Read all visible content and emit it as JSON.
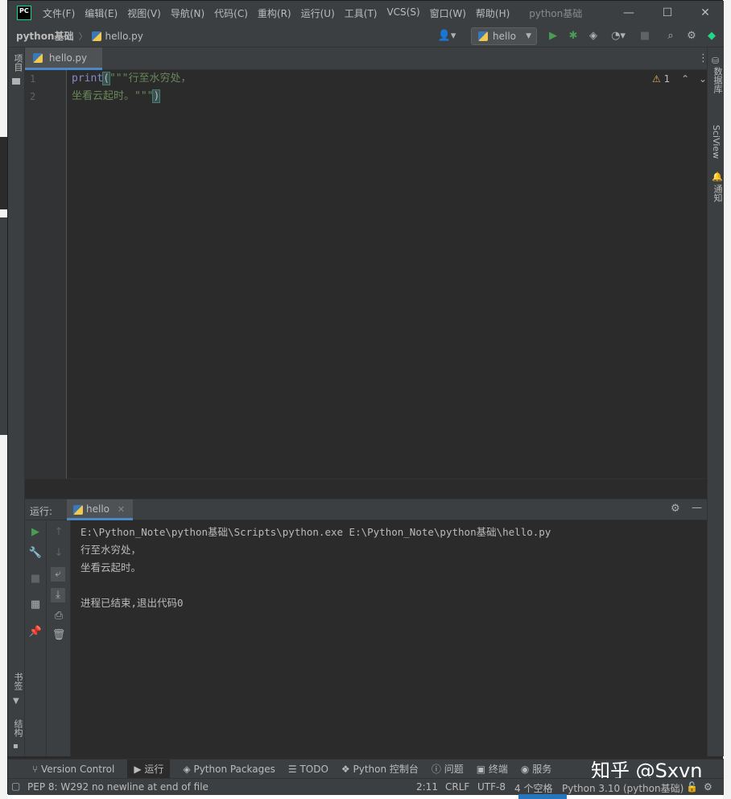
{
  "app": {
    "logo": "PC",
    "window_title": "python基础",
    "menu": [
      "文件(F)",
      "编辑(E)",
      "视图(V)",
      "导航(N)",
      "代码(C)",
      "重构(R)",
      "运行(U)",
      "工具(T)",
      "VCS(S)",
      "窗口(W)",
      "帮助(H)"
    ],
    "window_controls": {
      "minimize": "—",
      "maximize": "☐",
      "close": "✕"
    }
  },
  "navbar": {
    "project": "python基础",
    "file": "hello.py",
    "run_config": "hello"
  },
  "left_strip": {
    "project_label": "项目",
    "bookmarks_label": "书签",
    "structure_label": "结构"
  },
  "right_strip": {
    "database_label": "数据库",
    "sciview_label": "SciView",
    "notifications_label": "通知"
  },
  "editor": {
    "tab_label": "hello.py",
    "line_numbers": [
      "1",
      "2"
    ],
    "line1_func": "print",
    "line1_paren": "(",
    "line1_string": "\"\"\"行至水穷处，",
    "line2_string": "坐看云起时。\"\"\"",
    "line2_paren": ")",
    "inspection_count": "1"
  },
  "run": {
    "label": "运行:",
    "tab_label": "hello",
    "console": [
      "E:\\Python_Note\\python基础\\Scripts\\python.exe E:\\Python_Note\\python基础\\hello.py",
      "行至水穷处，",
      "坐看云起时。",
      "",
      "进程已结束,退出代码0"
    ]
  },
  "bottom_tools": [
    "Version Control",
    "运行",
    "Python Packages",
    "TODO",
    "Python 控制台",
    "问题",
    "终端",
    "服务"
  ],
  "watermark": "知乎 @Sxvn",
  "status": {
    "message": "PEP 8: W292 no newline at end of file",
    "position": "2:11",
    "line_sep": "CRLF",
    "encoding": "UTF-8",
    "indent": "4 个空格",
    "interpreter": "Python 3.10 (python基础)"
  },
  "colors": {
    "accent": "#4a88c7",
    "run_green": "#499c54",
    "background": "#2b2b2b",
    "panel": "#3c3f41"
  }
}
